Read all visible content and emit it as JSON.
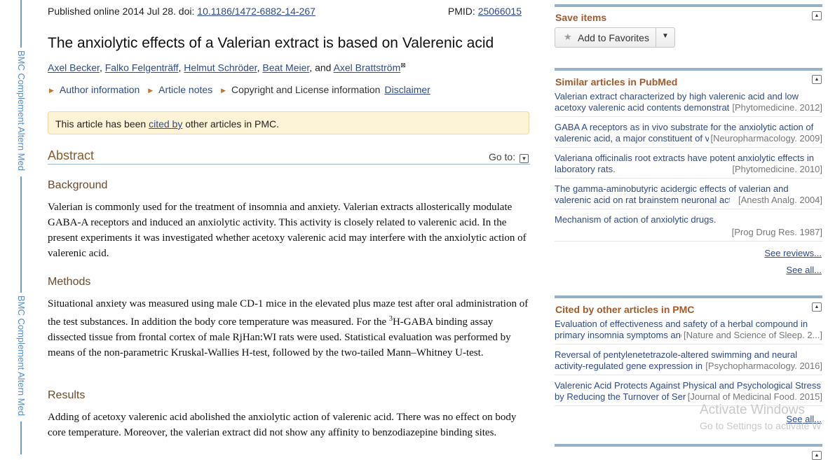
{
  "rail": {
    "journal_abbrev": "BMC Complement Altern Med"
  },
  "article": {
    "published_prefix": "Published online 2014 Jul 28. doi: ",
    "doi": "10.1186/1472-6882-14-267",
    "pmid_label": "PMID: ",
    "pmid": "25066015",
    "title": "The anxiolytic effects of a Valerian extract is based on Valerenic acid",
    "authors": [
      "Axel Becker",
      "Falko Felgenträff",
      "Helmut Schröder",
      "Beat Meier",
      "Axel Brattström"
    ],
    "and": "and",
    "author_mark": "⊠",
    "links": {
      "author_info": "Author information",
      "article_notes": "Article notes",
      "copyright": "Copyright and License information",
      "disclaimer": "Disclaimer"
    },
    "notice": {
      "prefix": "This article has been ",
      "link": "cited by",
      "suffix": " other articles in PMC."
    },
    "abstract_heading": "Abstract",
    "goto": "Go to:",
    "sections": [
      {
        "heading": "Background",
        "text": "Valerian is commonly used for the treatment of insomnia and anxiety. Valerian extracts allosterically modulate GABA-A receptors and induced an anxiolytic activity. This activity is closely related to valerenic acid. In the present experiments it was investigated whether acetoxy valerenic acid may interfere with the anxiolytic action of valerenic acid."
      },
      {
        "heading": "Methods",
        "text_a": "Situational anxiety was measured using male CD-1 mice in the elevated plus maze test after oral administration of the test substances. In addition the body core temperature was measured. For the ",
        "sup": "3",
        "text_b": "H-GABA binding assay dissected tissue from frontal cortex of male RjHan:WI rats were used. Statistical evaluation was performed by means of the non-parametric Kruskal-Wallies H-test, followed by the two-tailed Mann–Whitney U-test."
      },
      {
        "heading": "Results",
        "text": "Adding of acetoxy valerenic acid abolished the anxiolytic action of valerenic acid. There was no effect on body core temperature. Moreover, the valerian extract did not show any affinity to benzodiazepine binding sites."
      }
    ]
  },
  "sidebar": {
    "save": {
      "title": "Save items",
      "button": "Add to Favorites"
    },
    "similar": {
      "title": "Similar articles in PubMed",
      "items": [
        {
          "l1": "Valerian extract characterized by high valerenic acid and low",
          "l2": "acetoxy valerenic acid contents demonstrated",
          "src": "[Phytomedicine. 2012]"
        },
        {
          "l1": "GABA A receptors as in vivo substrate for the anxiolytic action of",
          "l2": "valerenic acid, a major constituent of valerian",
          "src": "[Neuropharmacology. 2009]"
        },
        {
          "l1": "Valeriana officinalis root extracts have potent anxiolytic effects in",
          "l2": "laboratory rats.",
          "src": "[Phytomedicine. 2010]"
        },
        {
          "l1": "The gamma-aminobutyric acidergic effects of valerian and",
          "l2": "valerenic acid on rat brainstem neuronal activity",
          "src": "[Anesth Analg. 2004]"
        },
        {
          "l1": "Mechanism of action of anxiolytic drugs.",
          "l2": "",
          "src": "[Prog Drug Res. 1987]"
        }
      ],
      "see_reviews": "See reviews...",
      "see_all": "See all..."
    },
    "cited": {
      "title": "Cited by other articles in PMC",
      "items": [
        {
          "l1": "Evaluation of effectiveness and safety of a herbal compound in",
          "l2": "primary insomnia symptoms and",
          "src": "[Nature and Science of Sleep. 2...]"
        },
        {
          "l1": "Reversal of pentylenetetrazole-altered swimming and neural",
          "l2": "activity-regulated gene expression in",
          "src": "[Psychopharmacology. 2016]"
        },
        {
          "l1": "Valerenic Acid Protects Against Physical and Psychological Stress",
          "l2": "by Reducing the Turnover of Serotonin",
          "src": "[Journal of Medicinal Food. 2015]"
        }
      ],
      "see_all": "See all..."
    }
  },
  "watermark": {
    "line1": "Activate Windows",
    "line2": "Go to Settings to activate W"
  }
}
